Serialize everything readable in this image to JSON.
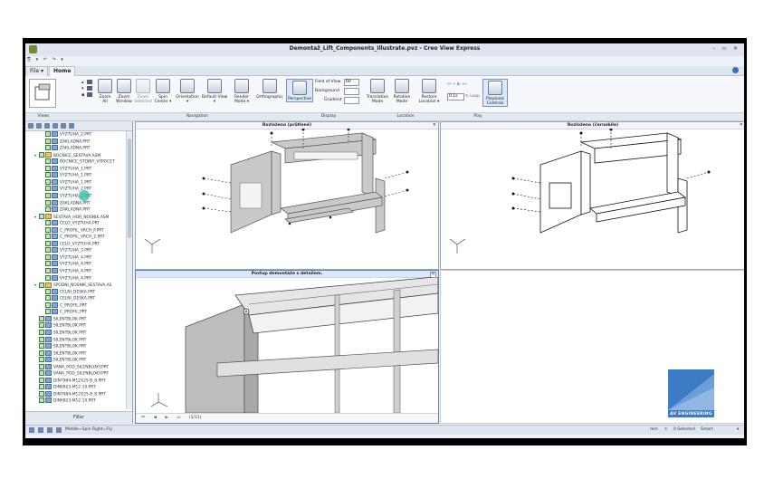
{
  "window": {
    "title": "Demontaž_Lift_Components_Illustrate.pvz - Creo View Express",
    "controls": "– ▫ ✕"
  },
  "quick_access": "⎘ ▾ ↶ ↷ ▾",
  "tabs": {
    "file": "File ▾",
    "home": "Home"
  },
  "ribbon": {
    "buttons": [
      {
        "label": "Zoom\nAll",
        "icon": "zoom-all-icon"
      },
      {
        "label": "Zoom\nWindow",
        "icon": "zoom-window-icon"
      },
      {
        "label": "Zoom\nSelected",
        "icon": "zoom-selected-icon"
      },
      {
        "label": "Spin\nCenter ▾",
        "icon": "spin-center-icon"
      },
      {
        "label": "Orientation\n▾",
        "icon": "orientation-icon"
      },
      {
        "label": "Default View\n▾",
        "icon": "default-view-icon"
      },
      {
        "label": "Render\nMode ▾",
        "icon": "render-mode-icon"
      },
      {
        "label": "Orthographic",
        "icon": "orthographic-icon"
      },
      {
        "label": "Perspective",
        "icon": "perspective-icon"
      },
      {
        "label": "Translation\nMode",
        "icon": "translation-mode-icon"
      },
      {
        "label": "Rotation\nMode",
        "icon": "rotation-mode-icon"
      },
      {
        "label": "Restore\nLocation ▾",
        "icon": "restore-location-icon"
      },
      {
        "label": "Playback\nControls",
        "icon": "playback-controls-icon"
      }
    ],
    "display": {
      "field_of_view_label": "Field of View",
      "field_of_view_value": "60",
      "background_label": "Background",
      "gradient_label": "Gradient"
    },
    "play": {
      "speed": "0.1s",
      "loop_label": "Loop"
    },
    "groups": {
      "views": "Views",
      "navigation": "Navigation",
      "display": "Display",
      "location": "Location",
      "play": "Play"
    }
  },
  "tree": {
    "nodes": [
      {
        "label": "VYZTUHA_2.PRT",
        "level": 2,
        "kind": "part"
      },
      {
        "label": "ZAKLADNA.PRT",
        "level": 2,
        "kind": "part"
      },
      {
        "label": "ZAKLADNA.PRT",
        "level": 2,
        "kind": "part"
      },
      {
        "label": "BOCNICE_SESTAVA.ASM",
        "level": 1,
        "kind": "asm",
        "expander": "▾"
      },
      {
        "label": "BOCNICE_STOJNY_VYPOCET",
        "level": 2,
        "kind": "part"
      },
      {
        "label": "VYZTUHA_1.PRT",
        "level": 2,
        "kind": "part"
      },
      {
        "label": "VYZTUHA_1.PRT",
        "level": 2,
        "kind": "part"
      },
      {
        "label": "VYZTUHA_1.PRT",
        "level": 2,
        "kind": "part"
      },
      {
        "label": "VYZTUHA_2.PRT",
        "level": 2,
        "kind": "part"
      },
      {
        "label": "VYZTUHA_2.PRT",
        "level": 2,
        "kind": "part"
      },
      {
        "label": "ZAKLADNA.PRT",
        "level": 2,
        "kind": "part"
      },
      {
        "label": "ZAKLADNA.PRT",
        "level": 2,
        "kind": "part"
      },
      {
        "label": "SESTAVA_HOR_NOSNIK.ASM",
        "level": 1,
        "kind": "asm",
        "expander": "▾"
      },
      {
        "label": "CELO_VYZTUHA.PRT",
        "level": 2,
        "kind": "part"
      },
      {
        "label": "C_PROFIL_VRCH_P.PRT",
        "level": 2,
        "kind": "part"
      },
      {
        "label": "C_PROFIL_VRCH_2.PRT",
        "level": 2,
        "kind": "part"
      },
      {
        "label": "CELO_VYZTUHA.PRT",
        "level": 2,
        "kind": "part"
      },
      {
        "label": "VYZTUHA_3.PRT",
        "level": 2,
        "kind": "part"
      },
      {
        "label": "VYZTUHA_4.PRT",
        "level": 2,
        "kind": "part"
      },
      {
        "label": "VYZTUHA_4.PRT",
        "level": 2,
        "kind": "part"
      },
      {
        "label": "VYZTUHA_4.PRT",
        "level": 2,
        "kind": "part"
      },
      {
        "label": "VYZTUHA_4.PRT",
        "level": 2,
        "kind": "part"
      },
      {
        "label": "SPODNI_NOSNIK_SESTAVA.AS",
        "level": 1,
        "kind": "asm",
        "expander": "▾"
      },
      {
        "label": "CELNI_DESKA.PRT",
        "level": 2,
        "kind": "part"
      },
      {
        "label": "CELNI_DESKA.PRT",
        "level": 2,
        "kind": "part"
      },
      {
        "label": "C_PROFIL.PRT",
        "level": 2,
        "kind": "part"
      },
      {
        "label": "C_PROFIL.PRT",
        "level": 2,
        "kind": "part"
      },
      {
        "label": "SILENTBLOK.PRT",
        "level": 1,
        "kind": "part"
      },
      {
        "label": "SILENTBLOK.PRT",
        "level": 1,
        "kind": "part"
      },
      {
        "label": "SILENTBLOK.PRT",
        "level": 1,
        "kind": "part"
      },
      {
        "label": "SILENTBLOK.PRT",
        "level": 1,
        "kind": "part"
      },
      {
        "label": "SILENTBLOK.PRT",
        "level": 1,
        "kind": "part"
      },
      {
        "label": "SILENTBLOK.PRT",
        "level": 1,
        "kind": "part"
      },
      {
        "label": "SILENTBLOK.PRT",
        "level": 1,
        "kind": "part"
      },
      {
        "label": "VANA_POD_SILENBLOKY.PRT",
        "level": 1,
        "kind": "part"
      },
      {
        "label": "VANA_POD_SILENBLOKY.PRT",
        "level": 1,
        "kind": "part"
      },
      {
        "label": "DIN7984-M12X25-8_8.PRT",
        "level": 1,
        "kind": "part"
      },
      {
        "label": "DIN6923-M12-10.PRT",
        "level": 1,
        "kind": "part"
      },
      {
        "label": "DIN7984-M12X25-8_8.PRT",
        "level": 1,
        "kind": "part"
      },
      {
        "label": "DIN6923-M12-10.PRT",
        "level": 1,
        "kind": "part"
      }
    ],
    "filter_label": "Filter"
  },
  "viewports": {
    "top_left_title": "Rozloženo (průtlené)",
    "top_right_title": "Rozloženo (černobíle)",
    "bottom_left_title": "Postup demontáže s detailem.",
    "close_symbol": "✕",
    "playbar": {
      "buttons": [
        "⏮",
        "◀",
        "▶",
        "⏭"
      ],
      "counter": "(1/11)"
    }
  },
  "logo": {
    "text": "AV ENGINEERING"
  },
  "status": {
    "mouse_hint": "Middle=Spin  Right=Fly",
    "unit": "mm",
    "selected": "0 Selected",
    "mode": "Smart"
  },
  "colors": {
    "accent": "#3c7bc6",
    "cursor_highlight": "#26bdaa",
    "active_header": "#dce8fb"
  }
}
